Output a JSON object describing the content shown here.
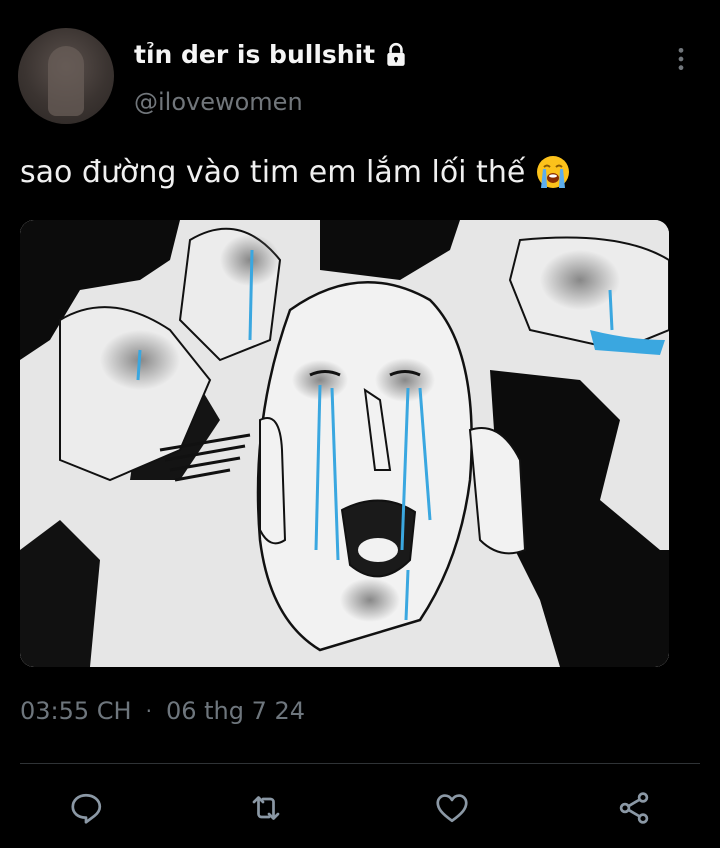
{
  "user": {
    "display_name": "tỉn der is bullshit",
    "handle": "@ilovewomen",
    "avatar_icon": "avatar",
    "protected_icon": "lock-icon"
  },
  "tweet": {
    "text": "sao đường vào tim em lắm lối thế",
    "emoji": "loudly-crying-face-icon"
  },
  "meta": {
    "time": "03:55 CH",
    "separator": "·",
    "date": "06 thg 7 24"
  },
  "actions": [
    {
      "name": "reply",
      "icon": "reply-icon"
    },
    {
      "name": "retweet",
      "icon": "retweet-icon"
    },
    {
      "name": "like",
      "icon": "heart-icon"
    },
    {
      "name": "share",
      "icon": "share-icon"
    }
  ],
  "colors": {
    "background": "#000000",
    "primary_text": "#e7e9ea",
    "secondary_text": "#71767b",
    "accent": "#1d9bf0",
    "tears": "#3aa7e0"
  }
}
